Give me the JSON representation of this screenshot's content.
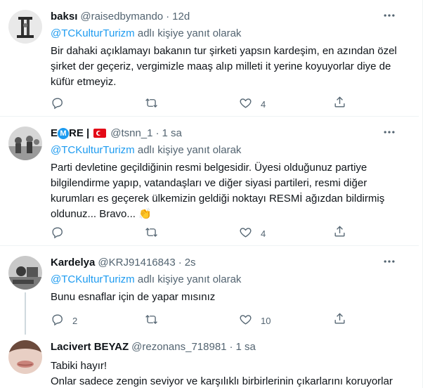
{
  "tweets": [
    {
      "name": "baksı",
      "handle": "@raisedbymando",
      "time": "12d",
      "reply_prefix": "@TCKulturTurizm",
      "reply_suffix": "adlı kişiye yanıt olarak",
      "text": "Bir dahaki açıklamayı bakanın tur şirketi yapsın kardeşim, en azından özel şirket der geçeriz, vergimizle maaş alıp milleti it yerine koyuyorlar diye de küfür etmeyiz.",
      "replies": "",
      "retweets": "",
      "likes": "4"
    },
    {
      "name_prefix": "E",
      "name_badge": "M",
      "name_suffix": "RE |",
      "handle": "@tsnn_1",
      "time": "1 sa",
      "reply_prefix": "@TCKulturTurizm",
      "reply_suffix": "adlı kişiye yanıt olarak",
      "text": "Parti devletine geçildiğinin resmi belgesidir. Üyesi olduğunuz partiye bilgilendirme yapıp, vatandaşları ve diğer siyasi partileri, resmi diğer kurumları es geçerek ülkemizin geldiği noktayı RESMİ ağızdan bildirmiş oldunuz... Bravo... 👏",
      "replies": "",
      "retweets": "",
      "likes": "4"
    },
    {
      "name": "Kardelya",
      "handle": "@KRJ91416843",
      "time": "2s",
      "reply_prefix": "@TCKulturTurizm",
      "reply_suffix": "adlı kişiye yanıt olarak",
      "text": "Bunu esnaflar için de yapar mısınız",
      "replies": "2",
      "retweets": "",
      "likes": "10"
    },
    {
      "name": "Lacivert BEYAZ",
      "handle": "@rezonans_718981",
      "time": "1 sa",
      "text": "Tabiki hayır!\nOnlar sadece zengin seviyor ve karşılıklı birbirlerinin çıkarlarını koruyorlar"
    }
  ],
  "separator": "·",
  "icons": {
    "more": "more-icon",
    "reply": "reply-icon",
    "retweet": "retweet-icon",
    "like": "like-icon",
    "share": "share-icon"
  },
  "colors": {
    "accent": "#1d9bf0",
    "secondary_text": "#536471",
    "divider": "#eff3f4",
    "thread_line": "#cfd9de"
  }
}
